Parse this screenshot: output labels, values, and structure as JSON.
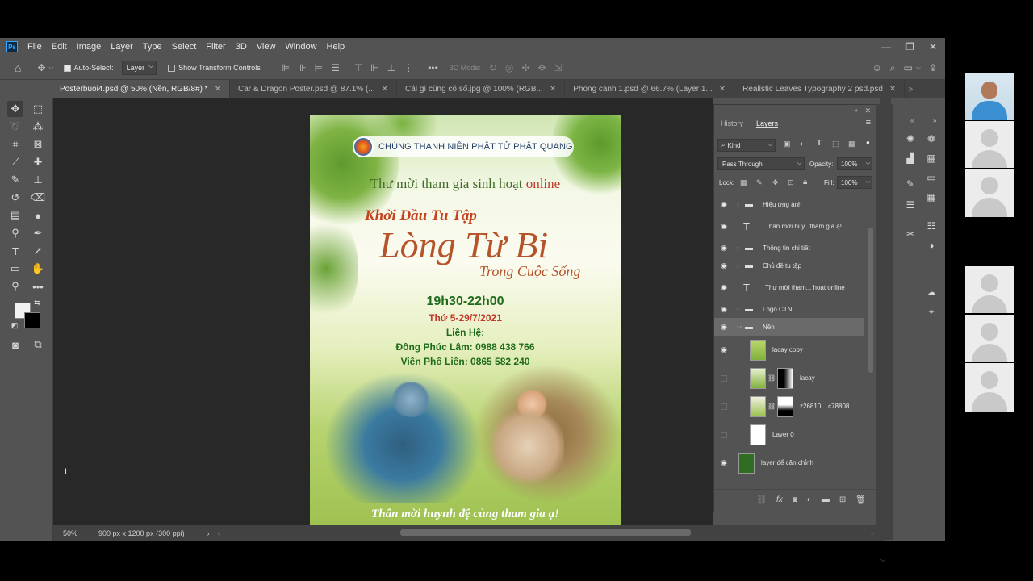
{
  "menubar": {
    "logo": "Ps",
    "items": [
      "File",
      "Edit",
      "Image",
      "Layer",
      "Type",
      "Select",
      "Filter",
      "3D",
      "View",
      "Window",
      "Help"
    ]
  },
  "options": {
    "auto_select_label": "Auto-Select:",
    "auto_select_value": "Layer",
    "show_transform_label": "Show Transform Controls",
    "mode_3d": "3D Mode:"
  },
  "tabs": [
    "Posterbuoi4.psd @ 50% (Nền, RGB/8#) *",
    "Car & Dragon Poster.psd @ 87.1% (...",
    "Cái gì cũng có số.jpg @ 100% (RGB...",
    "Phong canh 1.psd @ 66.7% (Layer 1...",
    "Realistic Leaves Typography 2 psd.psd"
  ],
  "poster": {
    "org_name": "CHÚNG THANH NIÊN PHẬT TỬ PHẬT QUANG",
    "invite_line_a": "Thư mời tham gia sinh hoạt",
    "invite_line_b": "online",
    "subtitle": "Khởi Đầu Tu Tập",
    "main_title": "Lòng Từ Bi",
    "tagline": "Trong Cuộc Sống",
    "time": "19h30-22h00",
    "date": "Thứ 5-29/7/2021",
    "contact_label": "Liên Hệ:",
    "contact_1": "Đồng Phúc Lâm: 0988 438 766",
    "contact_2": "Viên Phổ Liên: 0865 582 240",
    "footer": "Thân mời huynh đệ cùng tham gia ạ!"
  },
  "status": {
    "zoom": "50%",
    "doc_info": "900 px x 1200 px (300 ppi)"
  },
  "panel": {
    "tab_history": "History",
    "tab_layers": "Layers",
    "filter_kind": "Kind",
    "blend_mode": "Pass Through",
    "opacity_label": "Opacity:",
    "opacity_value": "100%",
    "lock_label": "Lock:",
    "fill_label": "Fill:",
    "fill_value": "100%"
  },
  "layers": [
    {
      "name": "Hiệu ứng ảnh",
      "kind": "folder",
      "visible": true
    },
    {
      "name": "Thân mời huy...tham gia ạ!",
      "kind": "text",
      "visible": true
    },
    {
      "name": "Thông tin chi tiết",
      "kind": "folder",
      "visible": true
    },
    {
      "name": "Chủ đề tu tập",
      "kind": "folder",
      "visible": true
    },
    {
      "name": "Thư mời tham... hoạt online",
      "kind": "text",
      "visible": true
    },
    {
      "name": "Logo CTN",
      "kind": "folder",
      "visible": true
    },
    {
      "name": "Nền",
      "kind": "folder-open",
      "visible": true
    },
    {
      "name": "lacay copy",
      "kind": "image",
      "visible": true
    },
    {
      "name": "lacay",
      "kind": "masked",
      "visible": false
    },
    {
      "name": "z26810....c78808",
      "kind": "masked",
      "visible": false
    },
    {
      "name": "Layer 0",
      "kind": "white",
      "visible": false
    },
    {
      "name": "layer để căn chỉnh",
      "kind": "green",
      "visible": true
    }
  ],
  "colors": {
    "accent_blue": "#31a8ff",
    "title_brown": "#b5532a",
    "time_green": "#1f6b1c",
    "date_red": "#c0392b"
  }
}
